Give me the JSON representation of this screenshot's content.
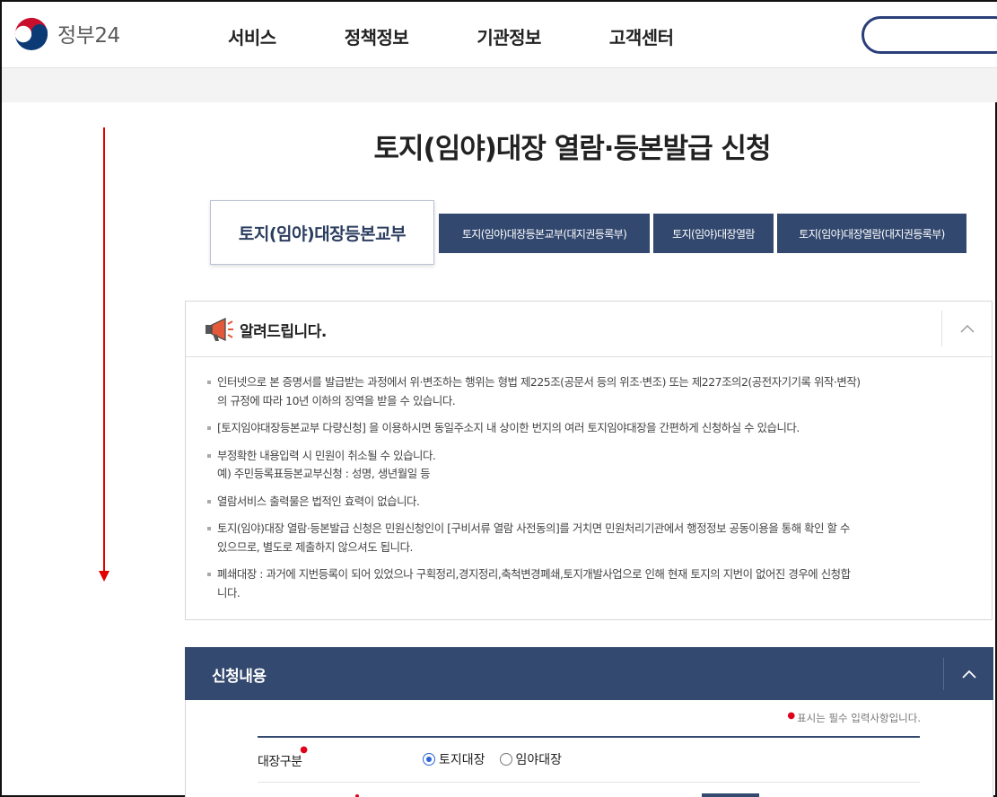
{
  "header": {
    "logo_text": "정부24",
    "nav": [
      "서비스",
      "정책정보",
      "기관정보",
      "고객센터"
    ]
  },
  "page": {
    "title": "토지(임야)대장 열람·등본발급 신청"
  },
  "tabs": {
    "active": "토지(임야)대장등본교부",
    "others": [
      "토지(임야)대장등본교부(대지권등록부)",
      "토지(임야)대장열람",
      "토지(임야)대장열람(대지권등록부)"
    ]
  },
  "notice": {
    "title": "알려드립니다.",
    "items": [
      [
        "인터넷으로 본 증명서를 발급받는 과정에서 위·변조하는 행위는 형법 제225조(공문서 등의 위조·변조) 또는 제227조의2(공전자기기록 위작·변작)",
        "의 규정에 따라 10년 이하의 징역을 받을 수 있습니다."
      ],
      [
        "[토지임야대장등본교부 다량신청] 을 이용하시면 동일주소지 내 상이한 번지의 여러 토지임야대장을 간편하게 신청하실 수 있습니다."
      ],
      [
        "부정확한 내용입력 시 민원이 취소될 수 있습니다.",
        "예) 주민등록표등본교부신청 : 성명, 생년월일 등"
      ],
      [
        "열람서비스 출력물은 법적인 효력이 없습니다."
      ],
      [
        "토지(임야)대장 열람·등본발급 신청은 민원신청인이 [구비서류 열람 사전동의]를 거치면 민원처리기관에서 행정정보 공동이용을 통해 확인 할 수",
        "있으므로, 별도로 제출하지 않으셔도 됩니다."
      ],
      [
        "폐쇄대장 : 과거에 지번등록이 되어 있었으나 구획정리,경지정리,축척변경폐쇄,토지개발사업으로 인해 현재 토지의 지번이 없어진 경우에 신청합",
        "니다."
      ]
    ]
  },
  "apply": {
    "title": "신청내용",
    "required_note": "표시는 필수 입력사항입니다.",
    "field_label": "대장구분",
    "options": [
      "토지대장",
      "임야대장"
    ],
    "selected": "토지대장"
  },
  "colors": {
    "navy": "#34496f",
    "required": "#e0001a",
    "radio": "#2a64d8",
    "arrow": "#e00000"
  },
  "icons": [
    "taegeuk-logo-icon",
    "megaphone-icon",
    "chevron-up-icon",
    "down-arrow-icon"
  ]
}
